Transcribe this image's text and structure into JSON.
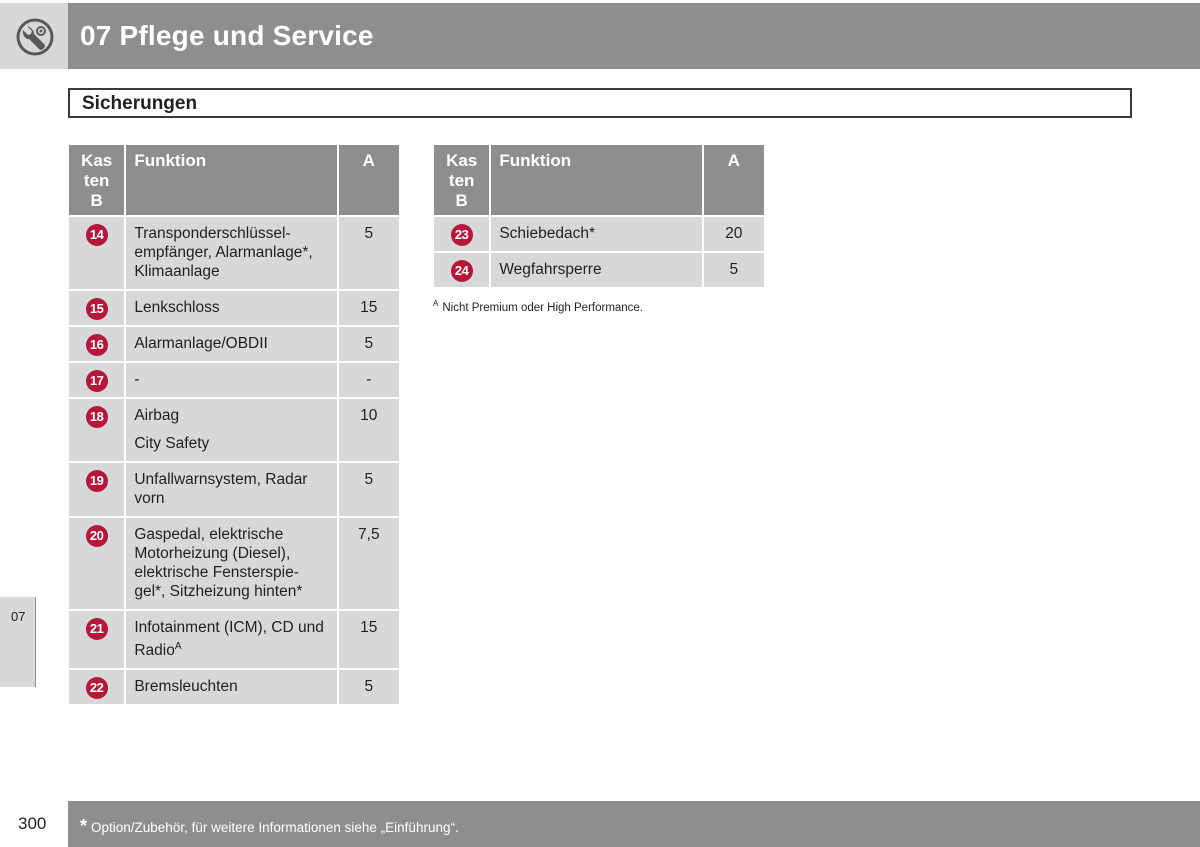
{
  "header": {
    "chapter_title": "07 Pflege und Service",
    "icon": "wrench-gear-icon"
  },
  "section": {
    "title": "Sicherungen"
  },
  "side_tab": {
    "label": "07"
  },
  "table_left": {
    "headers": {
      "box": "Kasten B",
      "box_line1": "Kas",
      "box_line2": "ten",
      "box_line3": "B",
      "function": "Funktion",
      "amp": "A"
    },
    "rows": [
      {
        "num": "14",
        "function": "Transponderschlüssel-empfänger, Alarmanlage*, Klimaanlage",
        "amp": "5"
      },
      {
        "num": "15",
        "function": "Lenkschloss",
        "amp": "15"
      },
      {
        "num": "16",
        "function": "Alarmanlage/OBDII",
        "amp": "5"
      },
      {
        "num": "17",
        "function": "-",
        "amp": "-"
      },
      {
        "num": "18",
        "function": "Airbag",
        "function_2": "City Safety",
        "amp": "10"
      },
      {
        "num": "19",
        "function": "Unfallwarnsystem, Radar vorn",
        "amp": "5"
      },
      {
        "num": "20",
        "function": "Gaspedal, elektrische Motorheizung (Diesel), elektrische Fensterspie-gel*, Sitzheizung hinten*",
        "amp": "7,5"
      },
      {
        "num": "21",
        "function": "Infotainment (ICM), CD und Radio",
        "function_sup": "A",
        "amp": "15"
      },
      {
        "num": "22",
        "function": "Bremsleuchten",
        "amp": "5"
      }
    ]
  },
  "table_right": {
    "headers": {
      "box_line1": "Kas",
      "box_line2": "ten",
      "box_line3": "B",
      "function": "Funktion",
      "amp": "A"
    },
    "rows": [
      {
        "num": "23",
        "function": "Schiebedach*",
        "amp": "20"
      },
      {
        "num": "24",
        "function": "Wegfahrsperre",
        "amp": "5"
      }
    ]
  },
  "footnote": {
    "marker": "A",
    "text": "Nicht Premium oder High Performance."
  },
  "footer": {
    "page_number": "300",
    "star": "*",
    "text": "Option/Zubehör, für weitere Informationen siehe „Einführung“."
  },
  "colors": {
    "header_gray": "#8d8e90",
    "cell_gray": "#d7d8d9",
    "badge_red": "#b5163a"
  }
}
